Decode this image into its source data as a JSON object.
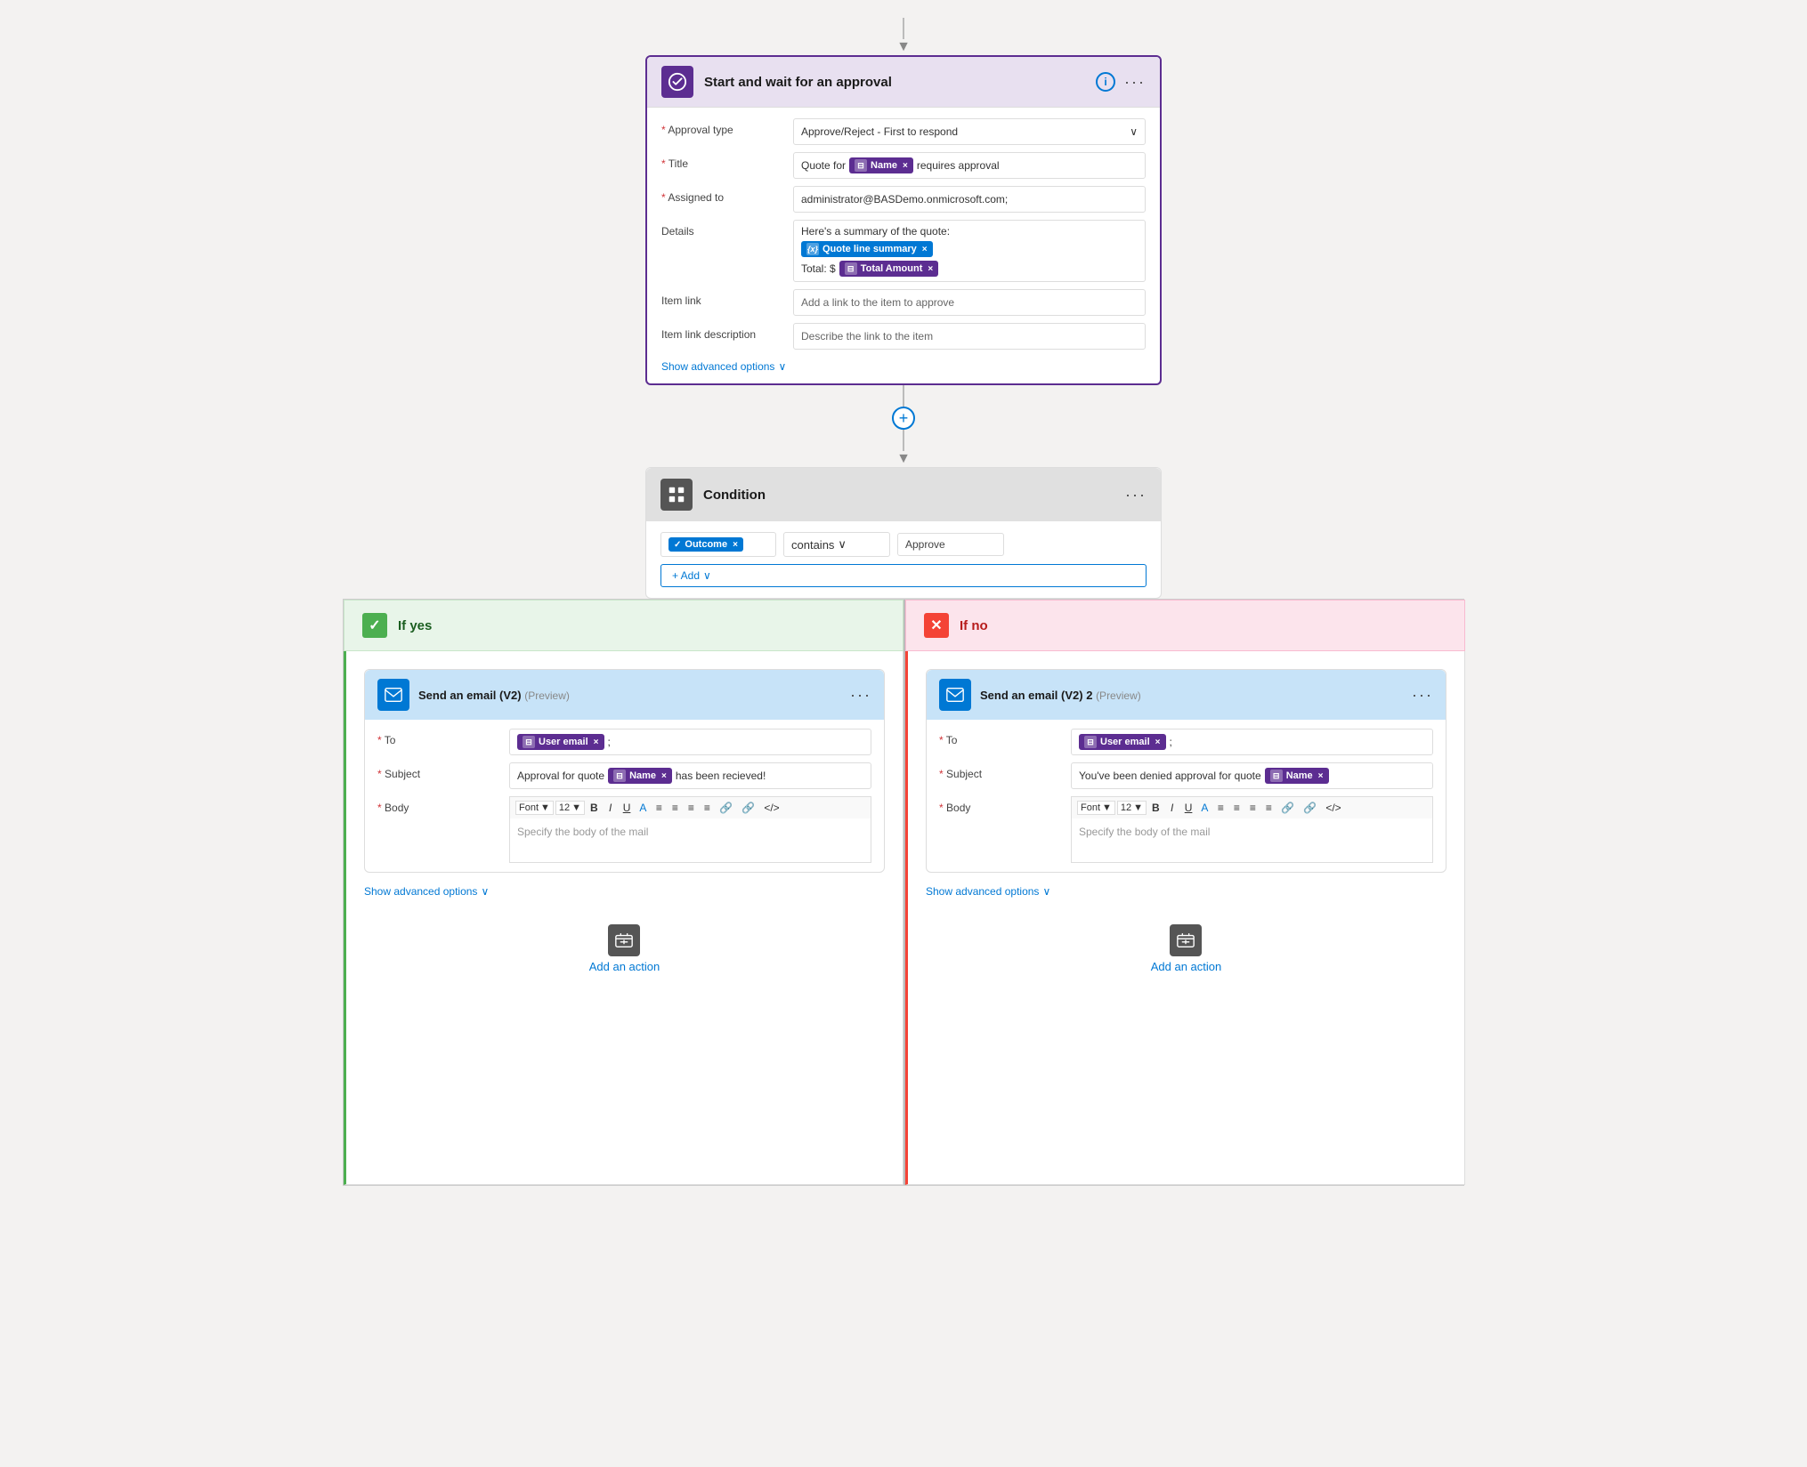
{
  "top_connector": {
    "arrow": "▼"
  },
  "approval_card": {
    "icon": "✓",
    "title": "Start and wait for an approval",
    "info_icon": "i",
    "ellipsis": "···",
    "fields": {
      "approval_type": {
        "label": "* Approval type",
        "value": "Approve/Reject - First to respond",
        "dropdown_arrow": "∨"
      },
      "title": {
        "label": "* Title",
        "prefix": "Quote for",
        "token1_label": "Name",
        "suffix": "requires approval"
      },
      "assigned_to": {
        "label": "* Assigned to",
        "value": "administrator@BASDemo.onmicrosoft.com;"
      },
      "details": {
        "label": "Details",
        "line1": "Here's a summary of the quote:",
        "token1_label": "Quote line summary",
        "line2_prefix": "Total: $",
        "token2_label": "Total Amount"
      },
      "item_link": {
        "label": "Item link",
        "placeholder": "Add a link to the item to approve"
      },
      "item_link_desc": {
        "label": "Item link description",
        "placeholder": "Describe the link to the item"
      }
    },
    "show_advanced": "Show advanced options",
    "show_advanced_chevron": "∨"
  },
  "mid_connector": {
    "plus": "+",
    "arrow": "▼"
  },
  "condition_card": {
    "icon": "⊞",
    "title": "Condition",
    "ellipsis": "···",
    "row": {
      "token_label": "Outcome",
      "operator": "contains",
      "operator_chevron": "∨",
      "value": "Approve"
    },
    "add_btn": "+ Add",
    "add_chevron": "∨"
  },
  "branch_yes": {
    "header": "If yes",
    "check_icon": "✓",
    "email_card": {
      "icon": "✉",
      "title": "Send an email (V2)",
      "preview": "(Preview)",
      "ellipsis": "···",
      "to_label": "* To",
      "to_token": "User email",
      "to_suffix": ";",
      "subject_label": "* Subject",
      "subject_prefix": "Approval for quote",
      "subject_token": "Name",
      "subject_suffix": "has been recieved!",
      "body_label": "* Body",
      "font_label": "Font",
      "font_size": "12",
      "body_placeholder": "Specify the body of the mail",
      "toolbar_items": [
        "B",
        "I",
        "U",
        "⁻",
        "≡",
        "≡",
        "≡",
        "≡",
        "⌂",
        "⌂",
        "</>"
      ]
    },
    "show_advanced": "Show advanced options",
    "show_advanced_chevron": "∨",
    "add_action": "Add an action"
  },
  "branch_no": {
    "header": "If no",
    "x_icon": "✕",
    "email_card": {
      "icon": "✉",
      "title": "Send an email (V2) 2",
      "preview": "(Preview)",
      "ellipsis": "···",
      "to_label": "* To",
      "to_token": "User email",
      "to_suffix": ";",
      "subject_label": "* Subject",
      "subject_prefix": "You've been denied approval for quote",
      "subject_token": "Name",
      "body_label": "* Body",
      "font_label": "Font",
      "font_size": "12",
      "body_placeholder": "Specify the body of the mail",
      "toolbar_items": [
        "B",
        "I",
        "U",
        "⁻",
        "≡",
        "≡",
        "≡",
        "≡",
        "⌂",
        "⌂",
        "</>"
      ]
    },
    "show_advanced": "Show advanced options",
    "show_advanced_chevron": "∨",
    "add_action": "Add an action"
  }
}
